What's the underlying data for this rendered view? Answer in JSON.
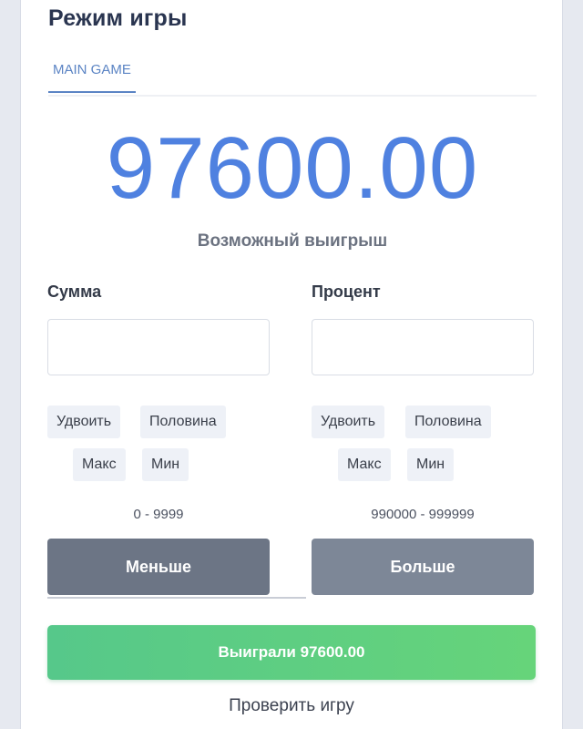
{
  "header": {
    "title": "Режим игры"
  },
  "tabs": [
    {
      "label": "MAIN GAME",
      "active": true
    }
  ],
  "result": {
    "amount": "97600.00",
    "label": "Возможный выигрыш"
  },
  "left_column": {
    "label": "Сумма",
    "input_value": "",
    "input_placeholder": "",
    "buttons": {
      "double": "Удвоить",
      "half": "Половина",
      "max": "Макс",
      "min": "Мин"
    },
    "range": "0 - 9999",
    "action_label": "Меньше"
  },
  "right_column": {
    "label": "Процент",
    "input_value": "",
    "input_placeholder": "",
    "buttons": {
      "double": "Удвоить",
      "half": "Половина",
      "max": "Макс",
      "min": "Мин"
    },
    "range": "990000 - 999999",
    "action_label": "Больше"
  },
  "win_button": {
    "label": "Выиграли 97600.00"
  },
  "check_link": {
    "label": "Проверить игру"
  },
  "colors": {
    "accent_blue": "#4f81e0",
    "win_green": "#5ccd82",
    "action_gray": "#6c7585"
  }
}
